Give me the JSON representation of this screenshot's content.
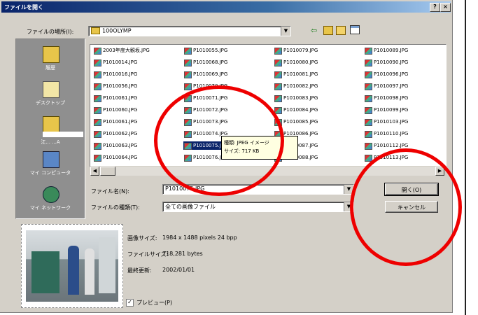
{
  "window": {
    "title": "ファイルを開く"
  },
  "toolbar": {
    "lookin_label": "ファイルの場所(I):",
    "lookin_value": "100OLYMP"
  },
  "places": [
    {
      "label": "履歴"
    },
    {
      "label": "デスクトップ"
    },
    {
      "label": "江... ...A"
    },
    {
      "label": "マイ コンピュータ"
    },
    {
      "label": "マイ ネットワーク"
    }
  ],
  "files": {
    "col1": [
      "2003年度大観坂.JPG",
      "P1010014.JPG",
      "P1010016.JPG",
      "P1010056.JPG",
      "P1010061.JPG",
      "P1010060.JPG",
      "P1010061.JPG",
      "P1010062.JPG",
      "P1010063.JPG",
      "P1010064.JPG"
    ],
    "col2": [
      "P1010055.JPG",
      "P1010068.JPG",
      "P1010069.JPG",
      "P1010070.JPG",
      "P1010071.JPG",
      "P1010072.JPG",
      "P1010073.JPG",
      "P1010074.JPG",
      "P1010075.JPG",
      "P1010076.JPG"
    ],
    "col3": [
      "P1010079.JPG",
      "P1010080.JPG",
      "P1010081.JPG",
      "P1010082.JPG",
      "P1010083.JPG",
      "P1010084.JPG",
      "P1010085.JPG",
      "P1010086.JPG",
      "P1010087.JPG",
      "P1010088.JPG"
    ],
    "col4": [
      "P1010089.JPG",
      "P1010090.JPG",
      "P1010096.JPG",
      "P1010097.JPG",
      "P1010098.JPG",
      "P1010099.JPG",
      "P1010103.JPG",
      "P1010110.JPG",
      "P1010112.JPG",
      "P1010113.JPG"
    ]
  },
  "tooltip": {
    "line1": "種類: JPEG イメージ",
    "line2": "サイズ: 717 KB"
  },
  "filename": {
    "label": "ファイル名(N):",
    "value": "P1010075.JPG"
  },
  "filetype": {
    "label": "ファイルの種類(T):",
    "value": "全ての画像ファイル"
  },
  "buttons": {
    "open": "開く(O)",
    "cancel": "キャンセル"
  },
  "info": {
    "size_label": "画像サイズ:",
    "size_value": "1984 x 1488 pixels 24 bpp",
    "filesize_label": "ファイルサイズ:",
    "filesize_value": "718,281 bytes",
    "modified_label": "最終更新:",
    "modified_value": "2002/01/01"
  },
  "preview_toggle": {
    "label": "プレビュー(P)",
    "checked": true
  },
  "colors": {
    "title_bar": "#0a246a",
    "dialog": "#d4d0c8",
    "selection": "#0a246a",
    "annotation": "#e00000"
  }
}
